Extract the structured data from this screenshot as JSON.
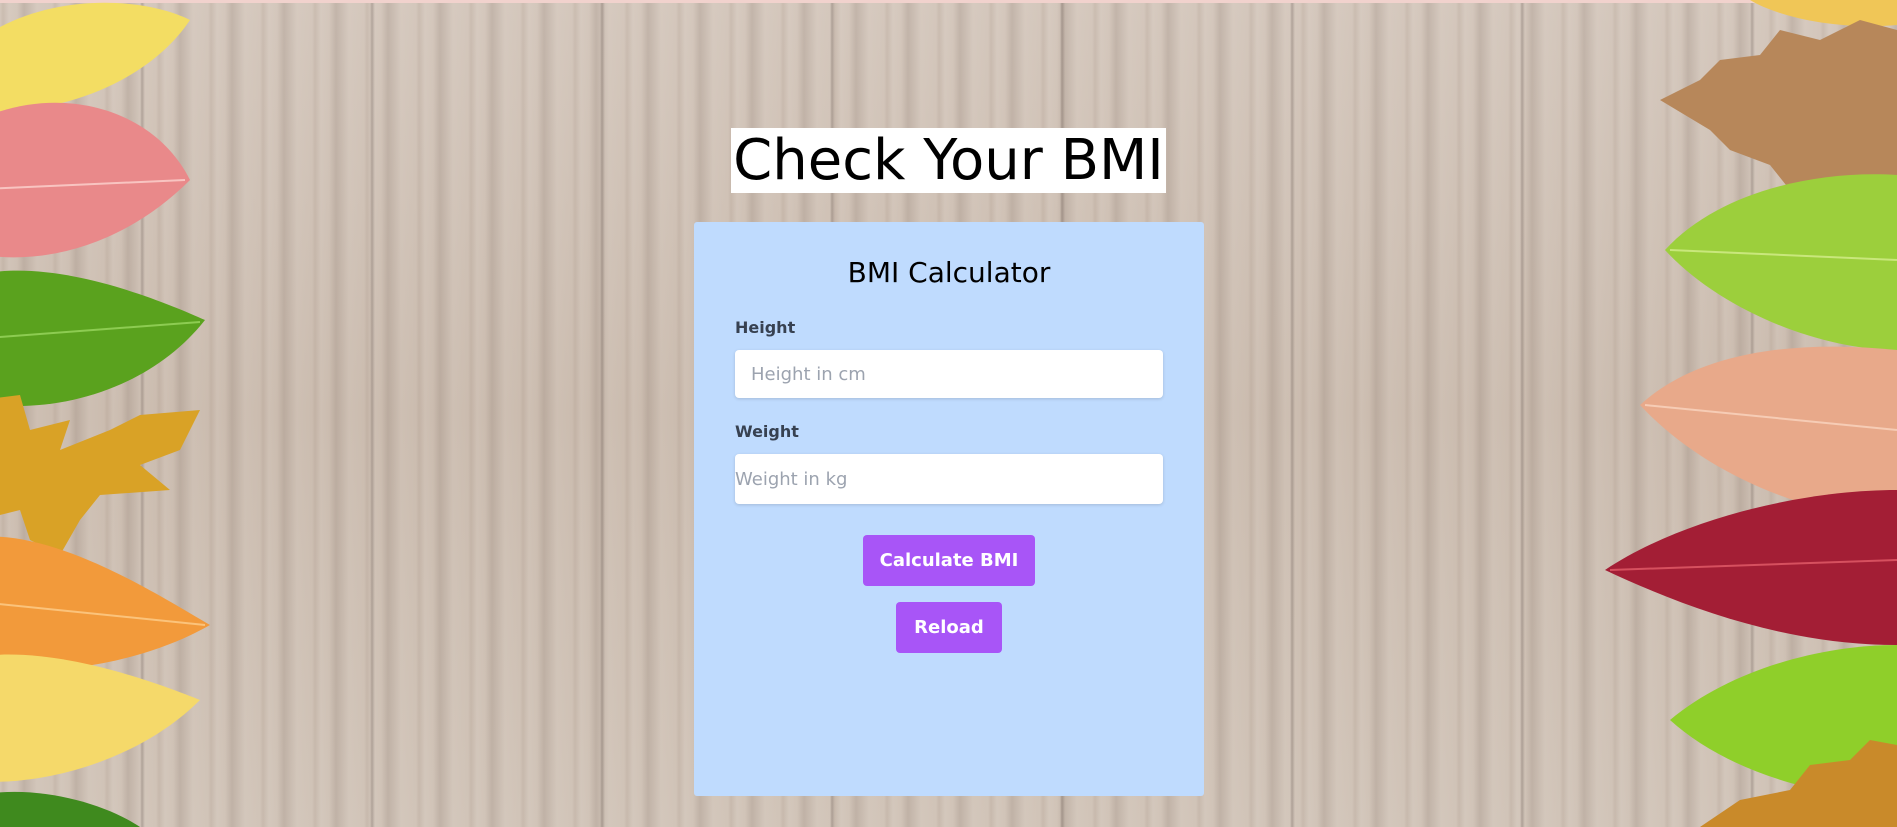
{
  "page": {
    "title": "Check Your BMI"
  },
  "calculator": {
    "title": "BMI Calculator",
    "height": {
      "label": "Height",
      "placeholder": "Height in cm",
      "value": ""
    },
    "weight": {
      "label": "Weight",
      "placeholder": "Weight in kg",
      "value": ""
    },
    "calculate_label": "Calculate BMI",
    "reload_label": "Reload"
  },
  "colors": {
    "card_background": "#bfdbfe",
    "button": "#a855f7",
    "button_text": "#ffffff"
  },
  "icons": {
    "background": "wood-plank-texture",
    "decoration": "autumn-leaves"
  }
}
